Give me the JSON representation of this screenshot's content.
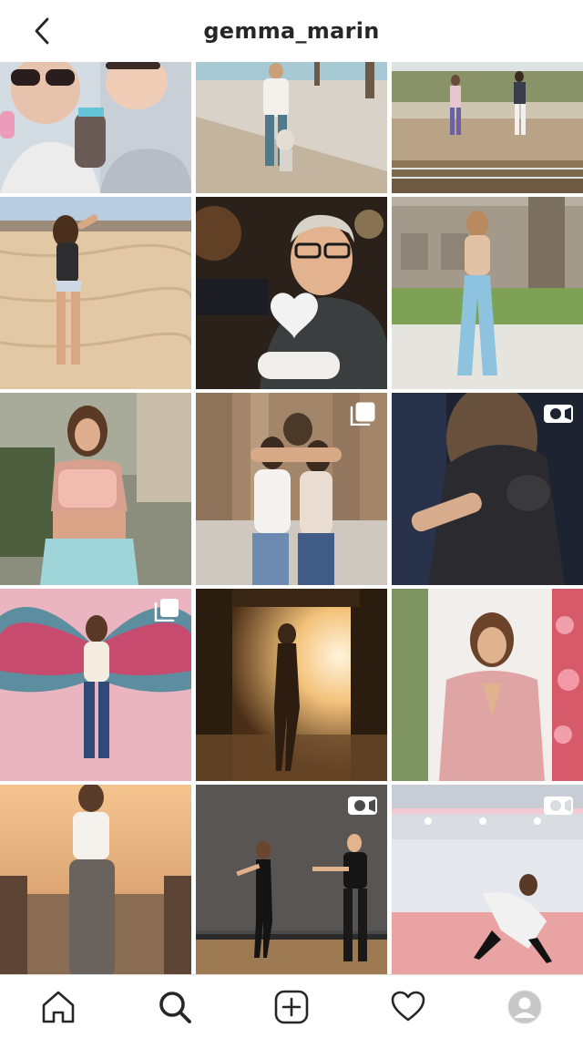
{
  "header": {
    "username": "gemma_marin",
    "back_icon": "chevron-left-icon"
  },
  "grid": {
    "posts": [
      {
        "badge": null,
        "palette": [
          "#d6dde4",
          "#eef2f5"
        ]
      },
      {
        "badge": null,
        "palette": [
          "#cfc4b6",
          "#e9e5e0"
        ]
      },
      {
        "badge": null,
        "palette": [
          "#b8a48a",
          "#d9d6cf"
        ]
      },
      {
        "badge": null,
        "palette": [
          "#e0c7a6",
          "#cfd8e3"
        ]
      },
      {
        "badge": null,
        "palette": [
          "#2b2622",
          "#7d6b55"
        ]
      },
      {
        "badge": null,
        "palette": [
          "#c8c0b2",
          "#7fa05c"
        ]
      },
      {
        "badge": null,
        "palette": [
          "#8a8a7a",
          "#dfb4a4"
        ]
      },
      {
        "badge": "carousel-icon",
        "palette": [
          "#b39d80",
          "#e8e4dd"
        ]
      },
      {
        "badge": "video-icon",
        "palette": [
          "#1f2433",
          "#3a4152"
        ]
      },
      {
        "badge": "carousel-icon",
        "palette": [
          "#e9b4c2",
          "#d99aaa"
        ]
      },
      {
        "badge": null,
        "palette": [
          "#3e2a16",
          "#f2c277"
        ]
      },
      {
        "badge": null,
        "palette": [
          "#f1ebe6",
          "#dba4a4"
        ]
      },
      {
        "badge": null,
        "palette": [
          "#e6b586",
          "#6a5443"
        ]
      },
      {
        "badge": "video-icon",
        "palette": [
          "#3c3c3c",
          "#7a6a55"
        ]
      },
      {
        "badge": "video-icon",
        "palette": [
          "#d9dde2",
          "#e8a9a9"
        ]
      }
    ]
  },
  "bottom_nav": {
    "items": [
      {
        "icon": "home-icon"
      },
      {
        "icon": "search-icon",
        "active": true
      },
      {
        "icon": "add-post-icon"
      },
      {
        "icon": "activity-heart-icon"
      },
      {
        "icon": "profile-avatar-icon"
      }
    ]
  }
}
